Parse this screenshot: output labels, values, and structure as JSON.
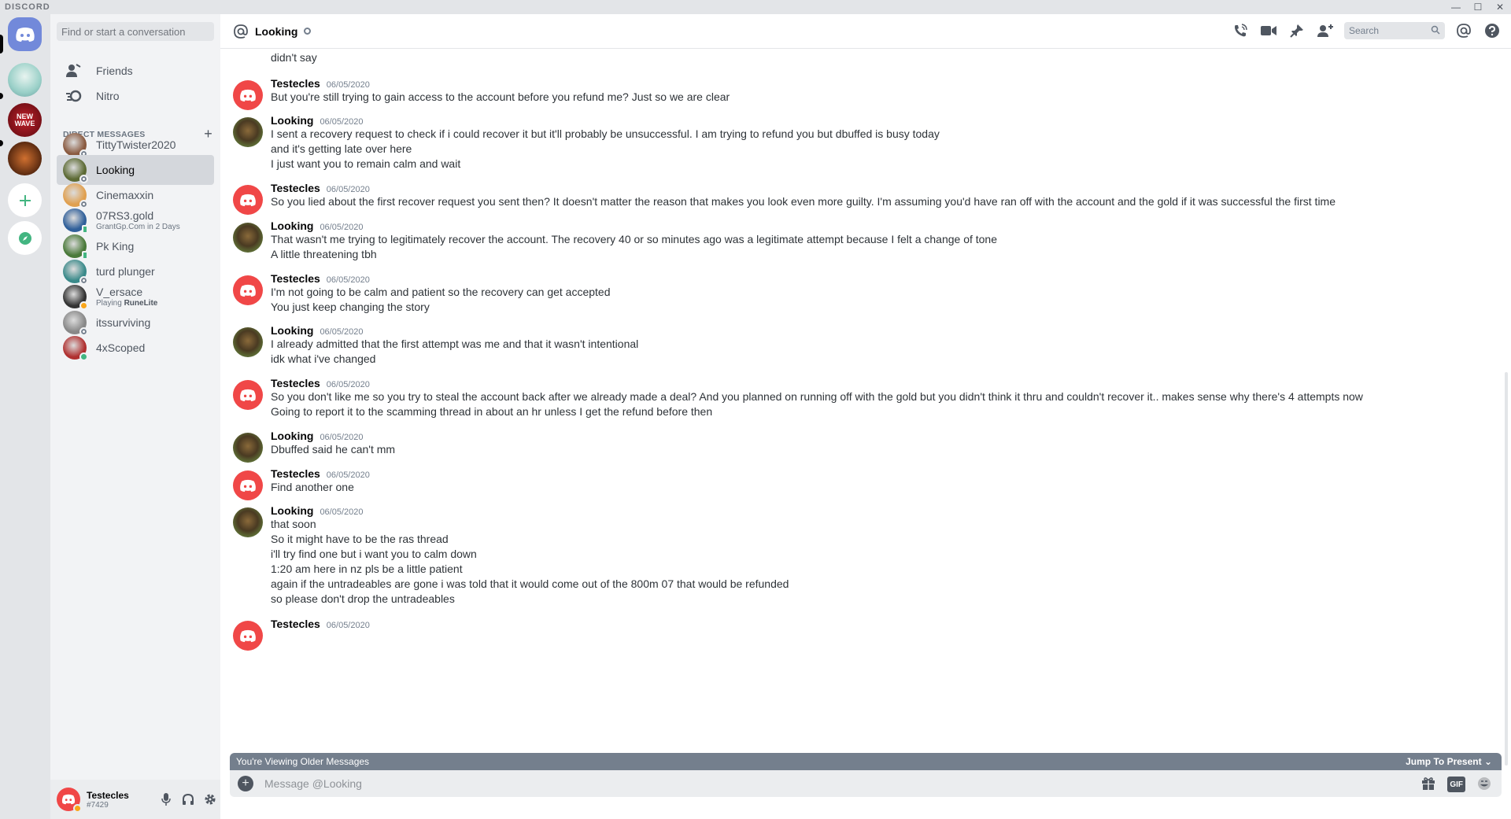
{
  "window": {
    "brand": "DISCORD",
    "minimize": "—",
    "maximize": "☐",
    "close": "✕"
  },
  "dm_panel": {
    "search_placeholder": "Find or start a conversation",
    "nav": [
      {
        "label": "Friends",
        "icon": "friends-icon"
      },
      {
        "label": "Nitro",
        "icon": "nitro-icon"
      }
    ],
    "header": "DIRECT MESSAGES",
    "add": "+",
    "items": [
      {
        "name": "TittyTwister2020",
        "sub": "",
        "status": "offline",
        "color": "#8a5a40"
      },
      {
        "name": "Looking",
        "sub": "",
        "status": "offline",
        "color": "#5c6a34",
        "active": true
      },
      {
        "name": "Cinemaxxin",
        "sub": "",
        "status": "offline",
        "color": "#e0a050"
      },
      {
        "name": "07RS3.gold",
        "sub": "GrantGp.Com in 2 Days",
        "status": "mobile",
        "color": "#2f5f9a"
      },
      {
        "name": "Pk King",
        "sub": "",
        "status": "mobile",
        "color": "#4a7a3a"
      },
      {
        "name": "turd plunger",
        "sub": "",
        "status": "offline",
        "color": "#3a8a8a"
      },
      {
        "name": "V_ersace",
        "sub_prefix": "Playing ",
        "sub_bold": "RuneLite",
        "status": "idle",
        "color": "#333333"
      },
      {
        "name": "itssurviving",
        "sub": "",
        "status": "offline",
        "color": "#888888"
      },
      {
        "name": "4xScoped",
        "sub": "",
        "status": "online",
        "color": "#b03030"
      }
    ]
  },
  "user": {
    "name": "Testecles",
    "tag": "#7429"
  },
  "chat": {
    "recipient": "Looking",
    "search_placeholder": "Search",
    "orphan_line": "didn't say",
    "messages": [
      {
        "author": "Testecles",
        "avatar": "testecles",
        "ts": "06/05/2020",
        "lines": [
          "But you're still trying to gain access to the account before you refund me? Just so we are clear"
        ]
      },
      {
        "author": "Looking",
        "avatar": "looking",
        "ts": "06/05/2020",
        "lines": [
          "I sent a recovery request to check if i could recover it but it'll probably be unsuccessful. I am trying to refund you but dbuffed is busy today",
          "and it's getting late over here",
          "I just want you to remain calm and wait"
        ]
      },
      {
        "author": "Testecles",
        "avatar": "testecles",
        "ts": "06/05/2020",
        "lines": [
          "So you lied about the first recover request you sent then? It doesn't matter the reason that makes you look even more guilty. I'm assuming you'd have ran off with the account and the gold if it was successful the first time"
        ]
      },
      {
        "author": "Looking",
        "avatar": "looking",
        "ts": "06/05/2020",
        "lines": [
          "That wasn't me trying to legitimately recover the account. The recovery 40 or so minutes ago was a legitimate attempt because I felt a change of tone",
          "A little threatening tbh"
        ]
      },
      {
        "author": "Testecles",
        "avatar": "testecles",
        "ts": "06/05/2020",
        "lines": [
          "I'm not going to be calm and patient so the recovery can get accepted",
          "You just keep changing the story"
        ]
      },
      {
        "author": "Looking",
        "avatar": "looking",
        "ts": "06/05/2020",
        "lines": [
          "I already admitted that the first attempt was me and that it wasn't intentional",
          "idk what i've changed"
        ]
      },
      {
        "author": "Testecles",
        "avatar": "testecles",
        "ts": "06/05/2020",
        "lines": [
          "So you don't like me so you try to steal the account back after we already made a deal? And you planned on running off with the gold but you didn't think it thru and couldn't recover it.. makes sense why there's 4 attempts now",
          "Going to report it to the scamming thread in about an hr unless I get the refund before then"
        ]
      },
      {
        "author": "Looking",
        "avatar": "looking",
        "ts": "06/05/2020",
        "lines": [
          "Dbuffed said he can't mm"
        ]
      },
      {
        "author": "Testecles",
        "avatar": "testecles",
        "ts": "06/05/2020",
        "lines": [
          "Find another one"
        ]
      },
      {
        "author": "Looking",
        "avatar": "looking",
        "ts": "06/05/2020",
        "lines": [
          "that soon",
          "So it might have to be the ras thread",
          "i'll try find one but i want you to calm down",
          "1:20 am here in nz pls be a little patient",
          "again if the untradeables are gone i was told that it would come out of the 800m 07 that would be refunded",
          "so please don't drop the untradeables"
        ]
      },
      {
        "author": "Testecles",
        "avatar": "testecles",
        "ts": "06/05/2020",
        "lines": []
      }
    ],
    "older_banner": "You're Viewing Older Messages",
    "jump_label": "Jump To Present",
    "composer_placeholder": "Message @Looking",
    "gif_label": "GIF"
  },
  "colors": {
    "blurple": "#7289da",
    "testecles_avatar": "#f04747",
    "online": "#43b581",
    "idle": "#faa61a"
  }
}
